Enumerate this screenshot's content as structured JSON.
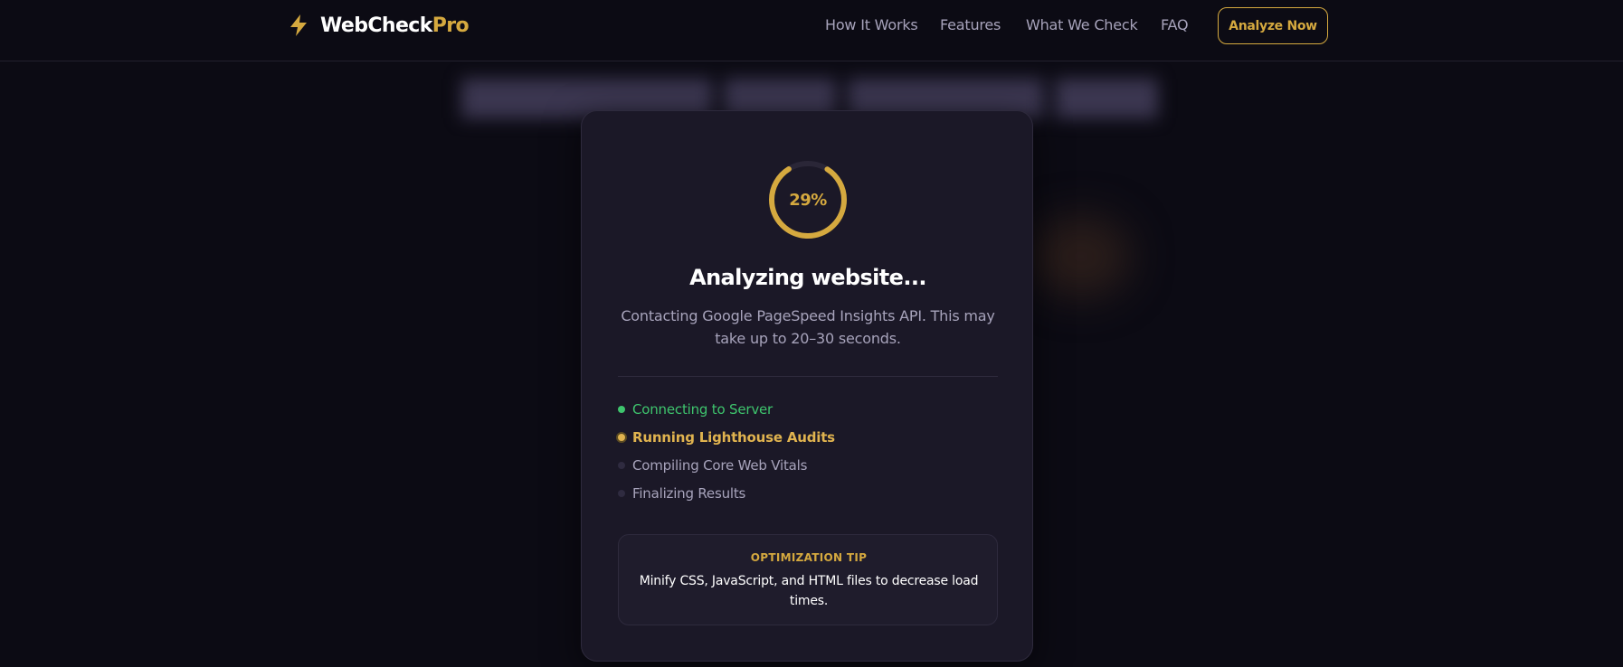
{
  "header": {
    "brand_primary": "WebCheck",
    "brand_accent": "Pro",
    "logo_icon": "lightning-bolt-icon",
    "nav": [
      "How It Works",
      "Features",
      "What We Check",
      "FAQ"
    ],
    "cta_label": "Analyze Now"
  },
  "modal": {
    "progress_percent": 29,
    "progress_label": "29%",
    "title": "Analyzing website...",
    "description": "Contacting Google PageSpeed Insights API. This may take up to 20–30 seconds.",
    "steps": [
      {
        "label": "Connecting to Server",
        "status": "done"
      },
      {
        "label": "Running Lighthouse Audits",
        "status": "active"
      },
      {
        "label": "Compiling Core Web Vitals",
        "status": "pending"
      },
      {
        "label": "Finalizing Results",
        "status": "pending"
      }
    ],
    "tip_label": "OPTIMIZATION TIP",
    "tip_text": "Minify CSS, JavaScript, and HTML files to decrease load times."
  },
  "colors": {
    "accent": "#d5a93f",
    "success": "#3ec46d",
    "background": "#0c0b14",
    "card": "#1b1827"
  }
}
